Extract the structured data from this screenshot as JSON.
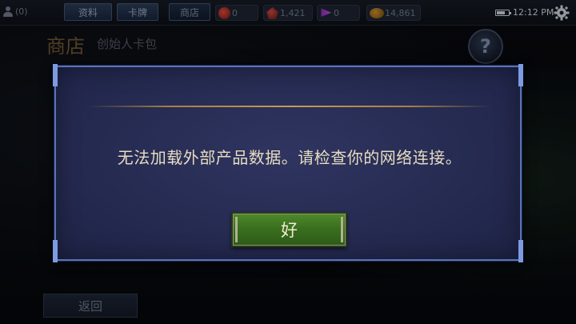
{
  "topbar": {
    "friends_count": "(0)",
    "nav": {
      "profile": "资料",
      "cards": "卡牌",
      "shop": "商店"
    },
    "currencies": [
      {
        "icon": "red-gem-icon",
        "value": "0"
      },
      {
        "icon": "red-shard-icon",
        "value": "1,421"
      },
      {
        "icon": "purple-flag-icon",
        "value": "0"
      },
      {
        "icon": "gold-coin-icon",
        "value": "14,861"
      }
    ],
    "time": "12:12 PM"
  },
  "page": {
    "title": "商店",
    "subtitle": "创始人卡包",
    "help_symbol": "?",
    "back_label": "返回"
  },
  "dialog": {
    "message": "无法加载外部产品数据。请检查你的网络连接。",
    "ok_label": "好"
  },
  "colors": {
    "dialog_bg": "#262b52",
    "dialog_border": "#5a72b8",
    "ok_button": "#3a6f1f",
    "divider_gold": "#c49a58",
    "title_bronze": "#6d5330"
  }
}
